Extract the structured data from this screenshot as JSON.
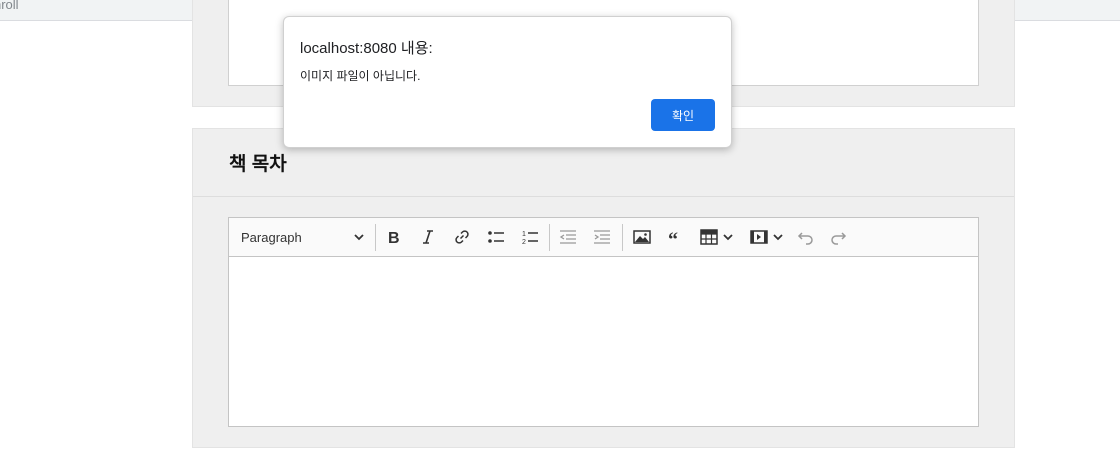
{
  "browser": {
    "top_text": "nroll"
  },
  "toc_section": {
    "title": "책 목차",
    "toolbar": {
      "paragraph_select": "Paragraph",
      "buttons": [
        "bold-icon",
        "italic-icon",
        "link-icon",
        "bulleted-list-icon",
        "numbered-list-icon",
        "outdent-icon",
        "indent-icon",
        "image-icon",
        "blockquote-icon",
        "table-icon",
        "media-icon",
        "undo-icon",
        "redo-icon"
      ]
    }
  },
  "dialog": {
    "title": "localhost:8080 내용:",
    "message": "이미지 파일이 아닙니다.",
    "ok_label": "확인",
    "accent": "#1a73e8"
  }
}
